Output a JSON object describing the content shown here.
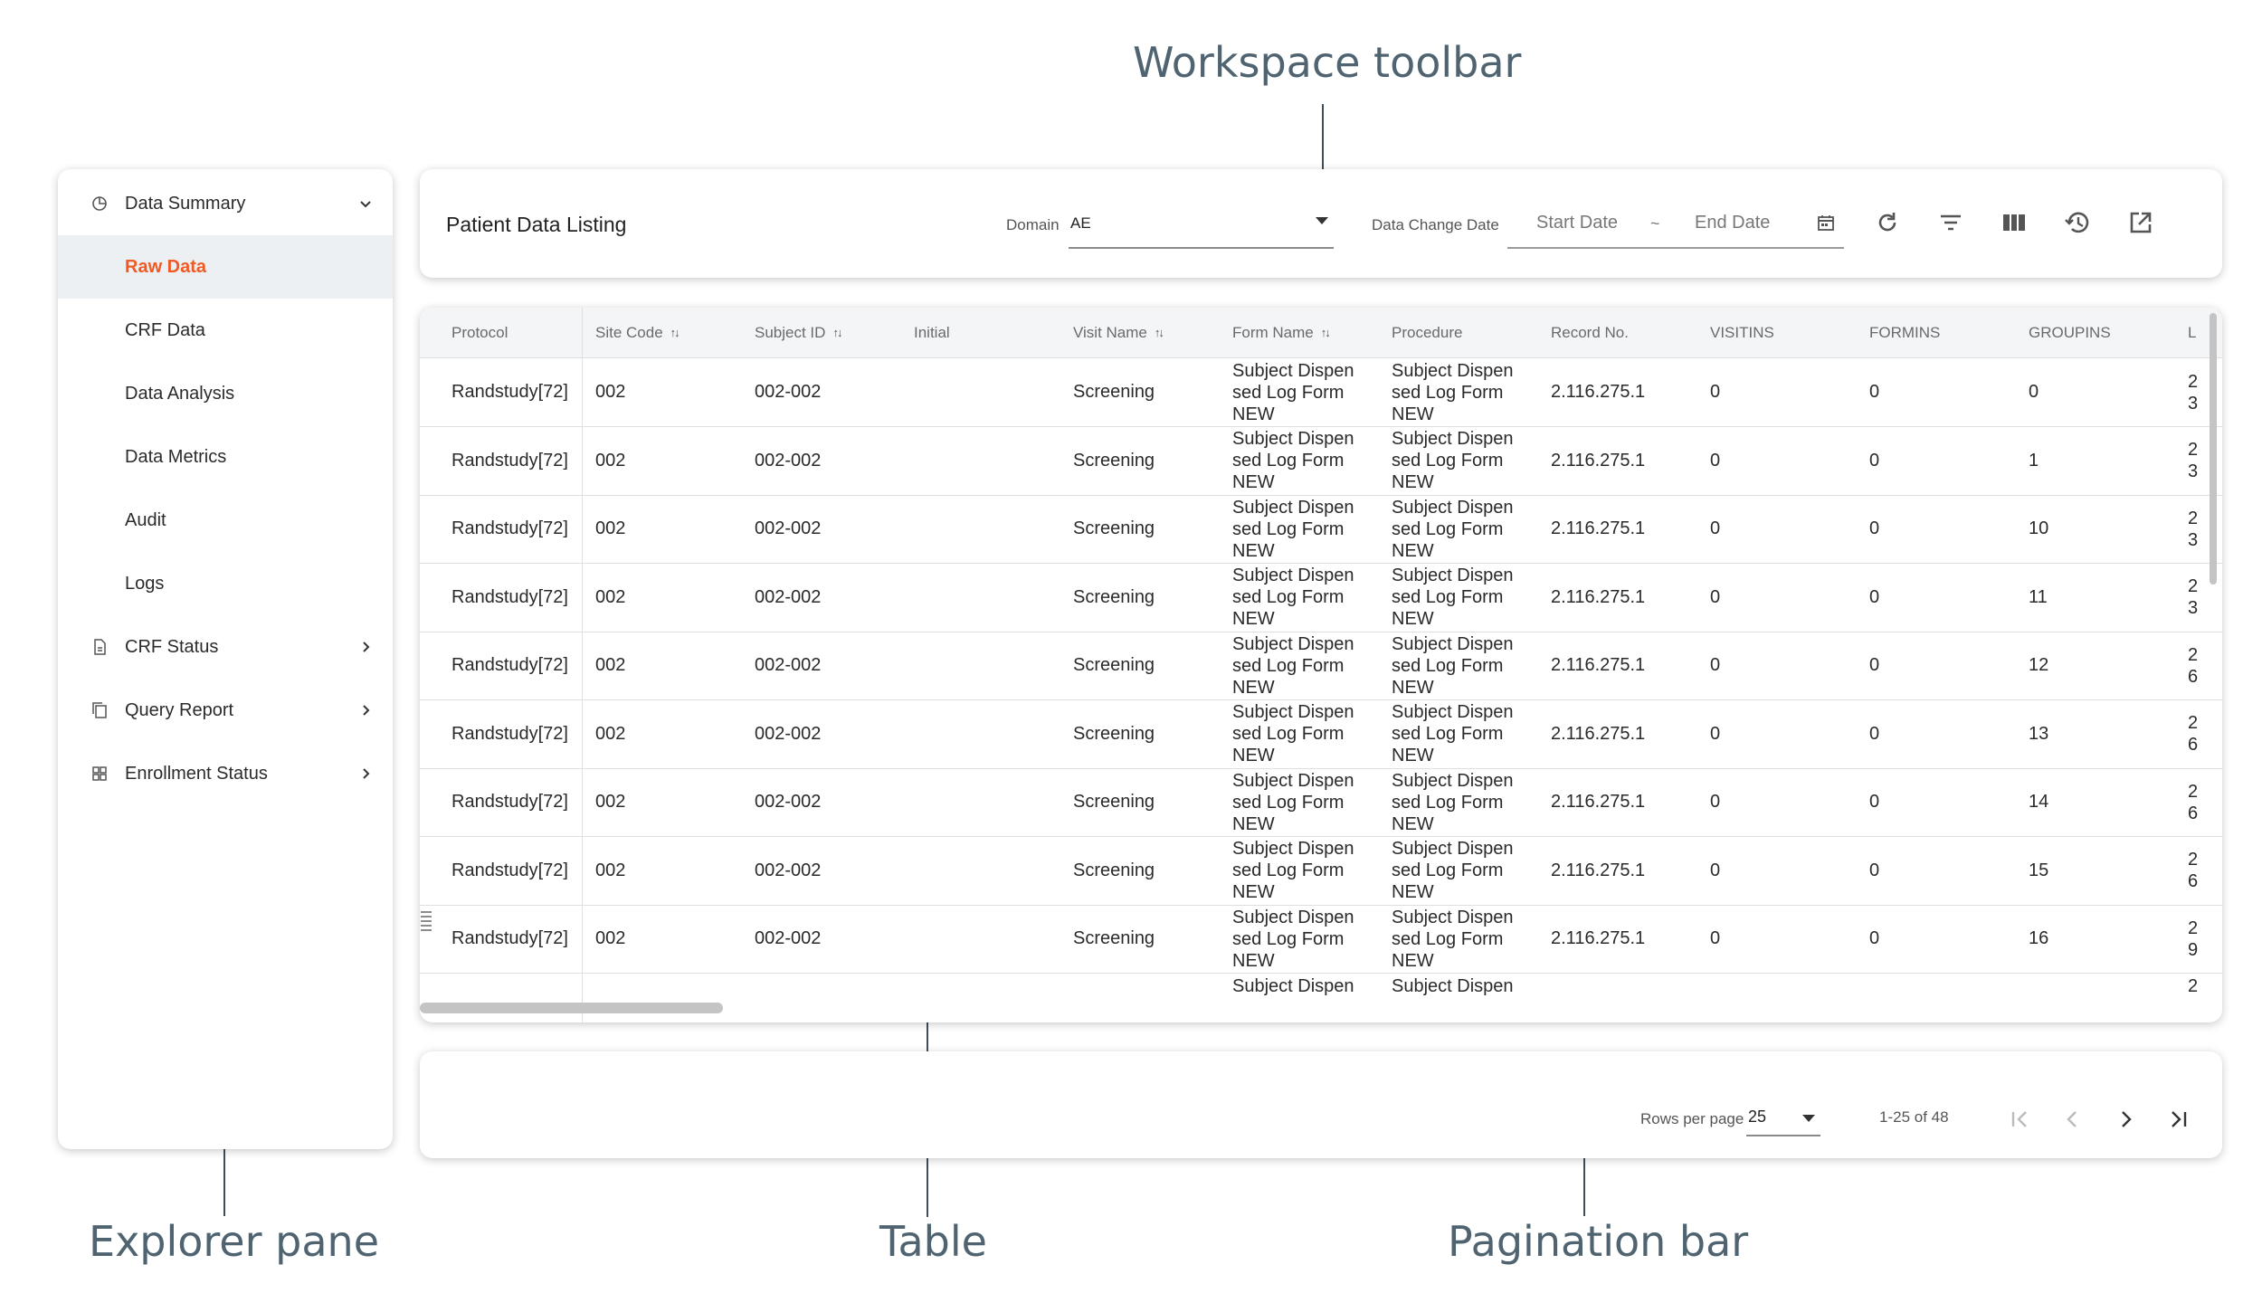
{
  "callouts": {
    "workspace_toolbar": "Workspace toolbar",
    "explorer_pane": "Explorer pane",
    "table": "Table",
    "pagination_bar": "Pagination bar"
  },
  "explorer": {
    "items": [
      {
        "label": "Data Summary",
        "icon": "pie-chart-icon",
        "chevron": "chevron-down-icon"
      },
      {
        "label": "Raw Data",
        "active": true
      },
      {
        "label": "CRF Data"
      },
      {
        "label": "Data Analysis"
      },
      {
        "label": "Data Metrics"
      },
      {
        "label": "Audit"
      },
      {
        "label": "Logs"
      },
      {
        "label": "CRF Status",
        "icon": "document-icon",
        "chevron": "chevron-right-icon"
      },
      {
        "label": "Query Report",
        "icon": "copy-icon",
        "chevron": "chevron-right-icon"
      },
      {
        "label": "Enrollment Status",
        "icon": "grid-icon",
        "chevron": "chevron-right-icon"
      }
    ]
  },
  "toolbar": {
    "title": "Patient Data Listing",
    "domain_label": "Domain",
    "domain_value": "AE",
    "date_change_label": "Data Change Date",
    "start_date_placeholder": "Start Date",
    "date_separator": "~",
    "end_date_placeholder": "End Date",
    "icons": [
      "calendar-icon",
      "refresh-icon",
      "filter-icon",
      "columns-icon",
      "history-icon",
      "export-icon"
    ]
  },
  "table": {
    "columns": [
      "Protocol",
      "Site Code",
      "Subject ID",
      "Initial",
      "Visit Name",
      "Form Name",
      "Procedure",
      "Record No.",
      "VISITINS",
      "FORMINS",
      "GROUPINS",
      "L"
    ],
    "rows": [
      {
        "protocol": "Randstudy[72]",
        "site": "002",
        "subject": "002-002",
        "initial": "",
        "visit": "Screening",
        "form": "Subject Dispen sed Log Form NEW",
        "procedure": "Subject Dispen sed Log Form NEW",
        "record": "2.116.275.1",
        "visitins": "0",
        "formins": "0",
        "groupins": "0",
        "last": "2 3"
      },
      {
        "protocol": "Randstudy[72]",
        "site": "002",
        "subject": "002-002",
        "initial": "",
        "visit": "Screening",
        "form": "Subject Dispen sed Log Form NEW",
        "procedure": "Subject Dispen sed Log Form NEW",
        "record": "2.116.275.1",
        "visitins": "0",
        "formins": "0",
        "groupins": "1",
        "last": "2 3"
      },
      {
        "protocol": "Randstudy[72]",
        "site": "002",
        "subject": "002-002",
        "initial": "",
        "visit": "Screening",
        "form": "Subject Dispen sed Log Form NEW",
        "procedure": "Subject Dispen sed Log Form NEW",
        "record": "2.116.275.1",
        "visitins": "0",
        "formins": "0",
        "groupins": "10",
        "last": "2 3"
      },
      {
        "protocol": "Randstudy[72]",
        "site": "002",
        "subject": "002-002",
        "initial": "",
        "visit": "Screening",
        "form": "Subject Dispen sed Log Form NEW",
        "procedure": "Subject Dispen sed Log Form NEW",
        "record": "2.116.275.1",
        "visitins": "0",
        "formins": "0",
        "groupins": "11",
        "last": "2 3"
      },
      {
        "protocol": "Randstudy[72]",
        "site": "002",
        "subject": "002-002",
        "initial": "",
        "visit": "Screening",
        "form": "Subject Dispen sed Log Form NEW",
        "procedure": "Subject Dispen sed Log Form NEW",
        "record": "2.116.275.1",
        "visitins": "0",
        "formins": "0",
        "groupins": "12",
        "last": "2 6"
      },
      {
        "protocol": "Randstudy[72]",
        "site": "002",
        "subject": "002-002",
        "initial": "",
        "visit": "Screening",
        "form": "Subject Dispen sed Log Form NEW",
        "procedure": "Subject Dispen sed Log Form NEW",
        "record": "2.116.275.1",
        "visitins": "0",
        "formins": "0",
        "groupins": "13",
        "last": "2 6"
      },
      {
        "protocol": "Randstudy[72]",
        "site": "002",
        "subject": "002-002",
        "initial": "",
        "visit": "Screening",
        "form": "Subject Dispen sed Log Form NEW",
        "procedure": "Subject Dispen sed Log Form NEW",
        "record": "2.116.275.1",
        "visitins": "0",
        "formins": "0",
        "groupins": "14",
        "last": "2 6"
      },
      {
        "protocol": "Randstudy[72]",
        "site": "002",
        "subject": "002-002",
        "initial": "",
        "visit": "Screening",
        "form": "Subject Dispen sed Log Form NEW",
        "procedure": "Subject Dispen sed Log Form NEW",
        "record": "2.116.275.1",
        "visitins": "0",
        "formins": "0",
        "groupins": "15",
        "last": "2 6"
      },
      {
        "protocol": "Randstudy[72]",
        "site": "002",
        "subject": "002-002",
        "initial": "",
        "visit": "Screening",
        "form": "Subject Dispen sed Log Form NEW",
        "procedure": "Subject Dispen sed Log Form NEW",
        "record": "2.116.275.1",
        "visitins": "0",
        "formins": "0",
        "groupins": "16",
        "last": "2 9"
      },
      {
        "protocol": "",
        "site": "",
        "subject": "",
        "initial": "",
        "visit": "",
        "form": "Subject Dispen",
        "procedure": "Subject Dispen",
        "record": "",
        "visitins": "",
        "formins": "",
        "groupins": "",
        "last": "2"
      }
    ]
  },
  "pagination": {
    "rows_per_page_label": "Rows per page",
    "rows_per_page_value": "25",
    "range_text": "1-25 of 48",
    "icons": [
      "first-page-icon",
      "prev-page-icon",
      "next-page-icon",
      "last-page-icon"
    ]
  },
  "colors": {
    "accent": "#ef5a25",
    "callout": "#4f6470",
    "active_bg": "#edf0f3"
  }
}
